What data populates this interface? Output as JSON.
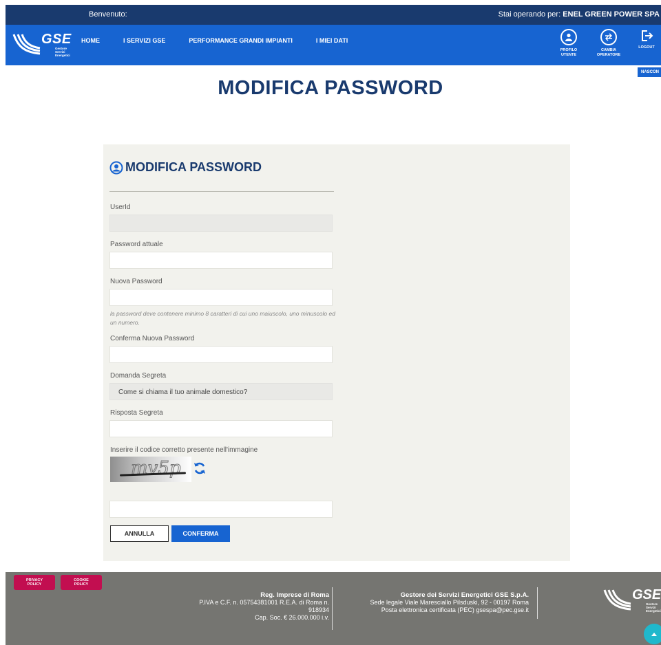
{
  "topbar": {
    "welcome": "Benvenuto:",
    "operating_label": "Stai operando per:",
    "operating_value": "ENEL GREEN POWER SPA"
  },
  "logo": {
    "brand": "GSE",
    "sub_line1": "Gestore",
    "sub_line2": "Servizi",
    "sub_line3": "Energetici"
  },
  "nav": {
    "items": [
      {
        "label": "HOME"
      },
      {
        "label": "I SERVIZI GSE"
      },
      {
        "label": "PERFORMANCE GRANDI IMPIANTI"
      },
      {
        "label": "I MIEI DATI"
      }
    ],
    "profile_line1": "PROFILO",
    "profile_line2": "UTENTE",
    "change_line1": "CAMBIA",
    "change_line2": "OPERATORE",
    "logout": "LOGOUT",
    "hide": "NASCON"
  },
  "page": {
    "title": "MODIFICA PASSWORD"
  },
  "form": {
    "heading": "MODIFICA PASSWORD",
    "userid_label": "UserId",
    "userid_value": "",
    "current_password_label": "Password attuale",
    "new_password_label": "Nuova Password",
    "new_password_hint": "la password deve contenere minimo 8 caratteri di cui uno maiuscolo, uno minuscolo ed un numero.",
    "confirm_password_label": "Conferma Nuova Password",
    "secret_question_label": "Domanda Segreta",
    "secret_question_value": "Come si chiama il tuo animale domestico?",
    "secret_answer_label": "Risposta Segreta",
    "captcha_label": "Inserire il codice corretto presente nell'immagine",
    "captcha_text": "mv5p",
    "captcha_value": "",
    "cancel_label": "ANNULLA",
    "confirm_label": "CONFERMA"
  },
  "footer": {
    "privacy_line1": "PRIVACY",
    "privacy_line2": "POLICY",
    "cookie_line1": "COOKIE",
    "cookie_line2": "POLICY",
    "reg_title": "Reg. Imprese di Roma",
    "reg_line1": "P.IVA e C.F. n. 05754381001 R.E.A. di Roma n.",
    "reg_line2": "918934",
    "reg_line3": "Cap. Soc. € 26.000.000 i.v.",
    "company_title": "Gestore dei Servizi Energetici GSE S.p.A.",
    "company_line1": "Sede legale Viale Maresciallo Pilsduski, 92 - 00197 Roma",
    "company_line2": "Posta elettronica certificata (PEC) gsespa@pec.gse.it"
  },
  "colors": {
    "navy": "#193a6e",
    "blue": "#1764d1",
    "panel": "#f2f2ed",
    "footer": "#757571",
    "pink": "#c20e50",
    "teal": "#20b8cc"
  }
}
